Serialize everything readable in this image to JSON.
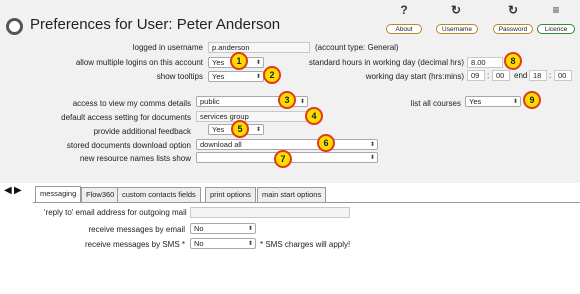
{
  "header": {
    "title": "Preferences for User: Peter Anderson",
    "toolbar": {
      "about_label": "About",
      "about_icon": "?",
      "username_label": "Username",
      "username_icon": "↻",
      "password_label": "Password",
      "password_icon": "↻",
      "licence_label": "Licence",
      "licence_icon": "≡"
    }
  },
  "form": {
    "logged_in_username_label": "logged in username",
    "logged_in_username_value": "p.anderson",
    "account_type": "(account type: General)",
    "allow_multiple_logins_label": "allow multiple logins on this account",
    "allow_multiple_logins_value": "Yes",
    "show_tooltips_label": "show tooltips",
    "show_tooltips_value": "Yes",
    "standard_hours_label": "standard hours in working day (decimal hrs)",
    "standard_hours_value": "8.00",
    "working_day_start_label": "working day start (hrs:mins)",
    "start_hours": "09",
    "start_mins": "00",
    "end_label": "end",
    "end_hours": "18",
    "end_mins": "00",
    "time_separator": ":",
    "access_comms_label": "access to view my comms details",
    "access_comms_value": "public",
    "default_access_label": "default access setting for documents",
    "default_access_value": "services group",
    "additional_feedback_label": "provide additional feedback",
    "additional_feedback_value": "Yes",
    "stored_documents_label": "stored documents download option",
    "stored_documents_value": "download all",
    "new_resource_label": "new resource names lists show",
    "new_resource_value": "",
    "list_all_courses_label": "list all courses",
    "list_all_courses_value": "Yes",
    "dropdown_arrow": "⬍"
  },
  "badges": [
    "1",
    "2",
    "3",
    "4",
    "5",
    "6",
    "7",
    "8",
    "9"
  ],
  "nav_arrows": {
    "left": "◀",
    "right": "▶"
  },
  "tabs": [
    {
      "label": "messaging"
    },
    {
      "label": "Flow360"
    },
    {
      "label": "custom contacts fields"
    },
    {
      "label": "print options"
    },
    {
      "label": "main start options"
    }
  ],
  "messaging": {
    "reply_to_label": "'reply to' email address for outgoing mail",
    "reply_to_value": "",
    "receive_email_label": "receive messages by email",
    "receive_email_value": "No",
    "receive_sms_label": "receive messages by SMS *",
    "receive_sms_value": "No",
    "sms_note": "* SMS charges will apply!"
  },
  "colors": {
    "badge_fill": "#ffdd00",
    "badge_border": "#e23a1a",
    "button_border": "#b8872a",
    "licence_border": "#2e8b3a"
  }
}
